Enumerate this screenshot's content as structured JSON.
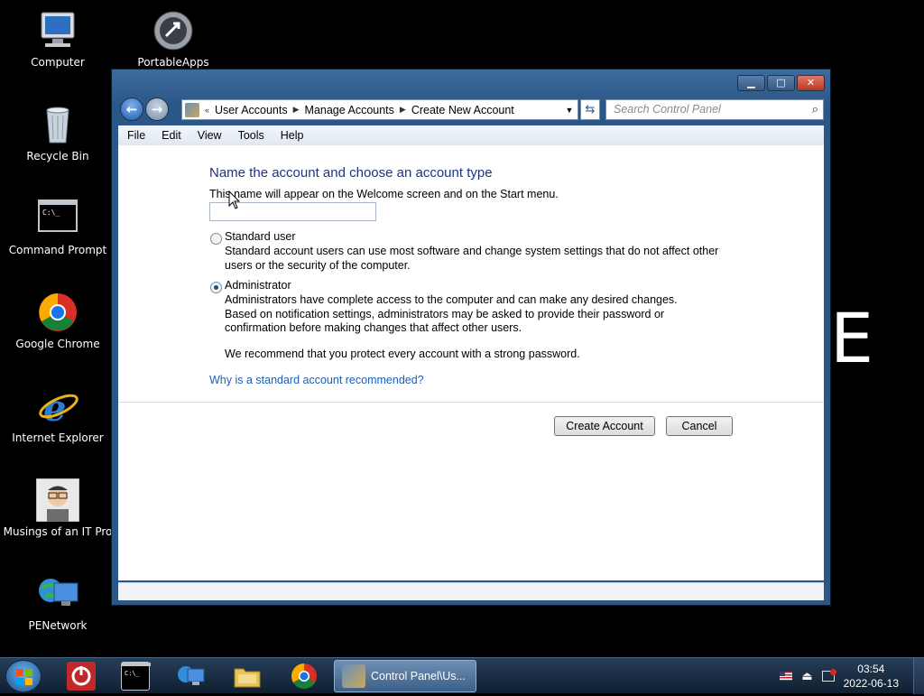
{
  "desktop": {
    "icons": [
      {
        "label": "Computer"
      },
      {
        "label": "PortableApps"
      },
      {
        "label": "Recycle Bin"
      },
      {
        "label": "Command Prompt"
      },
      {
        "label": "Google Chrome"
      },
      {
        "label": "Internet Explorer"
      },
      {
        "label": "Musings of an IT Pro"
      },
      {
        "label": "PENetwork"
      }
    ],
    "background_glyph": "E"
  },
  "window": {
    "caption_buttons": {
      "minimize": "▁",
      "maximize": "□",
      "close": "✕"
    },
    "breadcrumb": {
      "overflow": "«",
      "items": [
        "User Accounts",
        "Manage Accounts",
        "Create New Account"
      ]
    },
    "search": {
      "placeholder": "Search Control Panel"
    },
    "menu": [
      "File",
      "Edit",
      "View",
      "Tools",
      "Help"
    ],
    "page": {
      "heading": "Name the account and choose an account type",
      "description": "This name will appear on the Welcome screen and on the Start menu.",
      "name_value": "",
      "standard": {
        "label": "Standard user",
        "desc": "Standard account users can use most software and change system settings that do not affect other users or the security of the computer.",
        "checked": false
      },
      "admin": {
        "label": "Administrator",
        "desc": "Administrators have complete access to the computer and can make any desired changes. Based on notification settings, administrators may be asked to provide their password or confirmation before making changes that affect other users.",
        "checked": true
      },
      "recommend": "We recommend that you protect every account with a strong password.",
      "link": "Why is a standard account recommended?",
      "create_button": "Create Account",
      "cancel_button": "Cancel"
    }
  },
  "taskbar": {
    "active_task": "Control Panel\\Us...",
    "clock": {
      "time": "03:54",
      "date": "2022-06-13"
    }
  }
}
